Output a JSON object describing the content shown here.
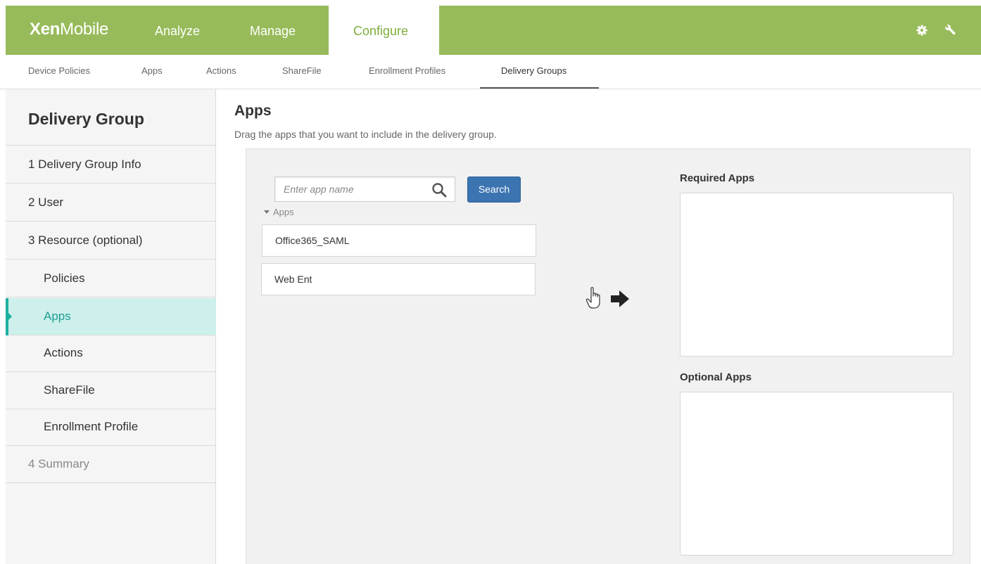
{
  "app": {
    "brand_bold": "Xen",
    "brand_light": "Mobile"
  },
  "topnav": {
    "items": [
      {
        "label": "Analyze"
      },
      {
        "label": "Manage"
      },
      {
        "label": "Configure",
        "active": true
      }
    ],
    "icons": [
      "gear-icon",
      "wrench-icon"
    ]
  },
  "subnav": {
    "items": [
      {
        "label": "Device Policies"
      },
      {
        "label": "Apps"
      },
      {
        "label": "Actions"
      },
      {
        "label": "ShareFile"
      },
      {
        "label": "Enrollment Profiles"
      },
      {
        "label": "Delivery Groups",
        "active": true
      }
    ]
  },
  "sidebar": {
    "title": "Delivery Group",
    "items": [
      {
        "label": "1  Delivery Group Info"
      },
      {
        "label": "2  User"
      },
      {
        "label": "3  Resource (optional)"
      },
      {
        "label": "Policies"
      },
      {
        "label": "Apps",
        "active": true
      },
      {
        "label": "Actions"
      },
      {
        "label": "ShareFile"
      },
      {
        "label": "Enrollment Profile"
      },
      {
        "label": "4  Summary"
      }
    ]
  },
  "main": {
    "title": "Apps",
    "subtitle": "Drag the apps that you want to include in the delivery group.",
    "search": {
      "placeholder": "Enter app name",
      "value": "",
      "button_label": "Search"
    },
    "apps_group_label": "Apps",
    "apps": [
      {
        "name": "Office365_SAML"
      },
      {
        "name": "Web Ent"
      }
    ],
    "required_label": "Required Apps",
    "optional_label": "Optional Apps"
  },
  "colors": {
    "brand_green": "#97bb5a",
    "active_teal": "#1cb0a0",
    "button_blue": "#3b74b0"
  }
}
